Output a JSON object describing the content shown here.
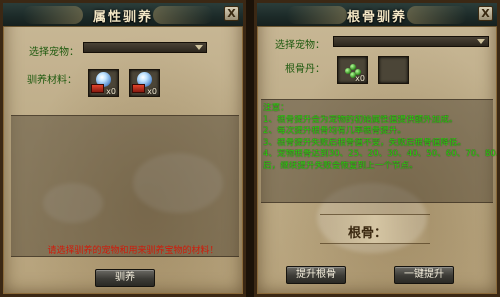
{
  "left_panel": {
    "title": "属性驯养",
    "close_label": "X",
    "select_pet_label": "选择宠物：",
    "material_label": "驯养材料：",
    "materials": [
      {
        "icon": "crystal-orb-icon",
        "count": "x0"
      },
      {
        "icon": "crystal-orb-icon",
        "count": "x0"
      }
    ],
    "warning": "请选择驯养的宠物和用来驯养宝物的材料！",
    "tame_button": "驯养"
  },
  "right_panel": {
    "title": "根骨驯养",
    "close_label": "X",
    "select_pet_label": "选择宠物：",
    "bone_fruit_label": "根骨丹：",
    "bone_fruit_count": "x0",
    "notes": [
      "注意：",
      "1、根骨提升会为宠物的初始属性值提供额外加成。",
      "2、每次提升根骨均有几率根骨提升。",
      "3、根骨提升失败后根骨值不变，失败后根骨值降低。",
      "4、宠物根骨达到30、25、20、30、40、50、60、70、80、90",
      "后，继续提升失败会恢复到上一个节点。"
    ],
    "bone_value_label": "根骨：",
    "upgrade_button": "提升根骨",
    "one_click_button": "一键提升"
  },
  "colors": {
    "label_green": "#1f5a0f",
    "note_green": "#2fd010",
    "warning_red": "#d11a0a",
    "title_text": "#f2e6c4"
  }
}
